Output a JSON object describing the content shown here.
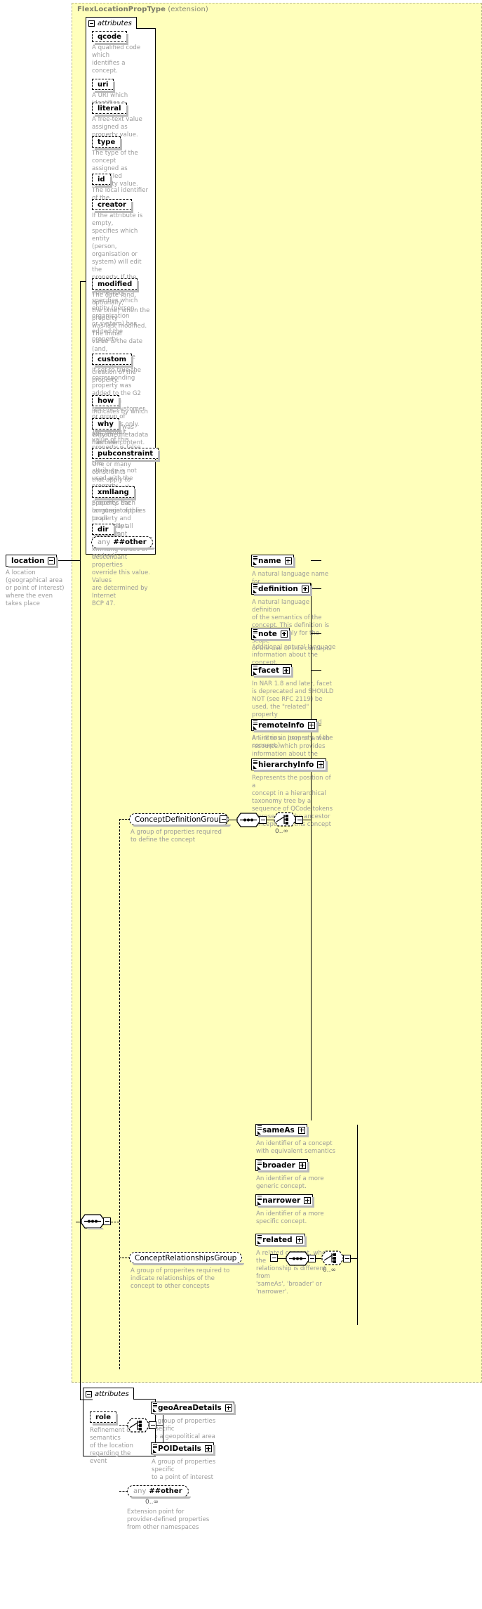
{
  "diagram": {
    "type_title_name": "FlexLocationPropType",
    "type_title_suffix": "(extension)",
    "attributes_label": "attributes",
    "attributes_label_bottom": "attributes"
  },
  "root": {
    "name": "location",
    "doc": "A location (geographical area\nor point of interest) where the even\ntakes place"
  },
  "type_attributes": [
    {
      "name": "qcode",
      "doc": "A qualified code which\nidentifies a concept."
    },
    {
      "name": "uri",
      "doc": "A URI which identifies a\nconcept."
    },
    {
      "name": "literal",
      "doc": "A free-text value assigned as\nproperty value."
    },
    {
      "name": "type",
      "doc": "The type of the concept\nassigned as controlled\nproperty value."
    },
    {
      "name": "id",
      "doc": "The local identifier of the\nproperty."
    },
    {
      "name": "creator",
      "doc": "If the attribute is empty,\nspecifies which entity\n(person, organisation or\nsystem) will edit the\nproperty. If the attribute is\nnon-empty, specifies which\nentity (person, organisation\nor system) has edited the\nproperty."
    },
    {
      "name": "modified",
      "doc": "The date (and, optionally,\nthe time) when the property\nwas last modified. The initial\nvalue is the date (and,\noptionally, the time) of\ncreation of the property."
    },
    {
      "name": "custom",
      "doc": "If set to true the\ncorresponding property was\nadded to the G2 Item for a\nspecific customer or group of\ncustomers only. The default\nvalue of this property is false\nwhich applies when this\nattribute is not used with the\nproperty."
    },
    {
      "name": "how",
      "doc": "Indicates by which means\nthe value was extracted\nfrom the content."
    },
    {
      "name": "why",
      "doc": "Why the metadata has been\nincluded."
    },
    {
      "name": "pubconstraint",
      "doc": "One or many constraints\nthat apply to publishing the\nvalue of the property. Each\nconstraint applies to all\ndescendant elements."
    },
    {
      "name": "xmllang",
      "doc": "Specifies the language of this\nproperty and potentially all\ndescendant properties.\nxml:lang values of\ndescendant properties\noverride this value. Values\nare determined by Internet\nBCP 47."
    },
    {
      "name": "dir",
      "doc": "The directionality of textual\ncontent."
    }
  ],
  "attr_any": {
    "any_word": "any",
    "namespace": "##other"
  },
  "groups": [
    {
      "name": "ConceptDefinitionGroup",
      "doc": "A group of properties required\nto define the concept",
      "occurs": "0..∞",
      "elements": [
        {
          "name": "name",
          "doc": "A natural language name for\nthe concept.",
          "expander": "plus"
        },
        {
          "name": "definition",
          "doc": "A natural language definition\nof the semantics of the\nconcept. This definition is\nnormative only for the scope\nof the use of this concept.",
          "expander": "plus"
        },
        {
          "name": "note",
          "doc": "Additional natural language\ninformation about the\nconcept.",
          "expander": "plus"
        },
        {
          "name": "facet",
          "doc": "In NAR 1.8 and later, facet\nis deprecated and SHOULD\nNOT (see RFC 2119) be\nused, the \"related\" property\nshould be used instead (was:\nAn intrinsic property of the\nconcept.)",
          "expander": "plus"
        },
        {
          "name": "remoteInfo",
          "doc": "A link to an item or a web\nresource which provides\ninformation about the\nconcept",
          "expander": "plus"
        },
        {
          "name": "hierarchyInfo",
          "doc": "Represents the position of a\nconcept in a hierarchical\ntaxonomy tree by a\nsequence of QCode tokens\nrepresenting the ancestor\nconcepts and this concept",
          "expander": "plus"
        }
      ]
    },
    {
      "name": "ConceptRelationshipsGroup",
      "doc": "A group of properites required to\nindicate relationships of the\nconcept to other concepts",
      "occurs": "0..∞",
      "elements": [
        {
          "name": "sameAs",
          "doc": "An identifier of a concept\nwith equivalent semantics",
          "expander": "plus"
        },
        {
          "name": "broader",
          "doc": "An identifier of a more\ngeneric concept.",
          "expander": "plus"
        },
        {
          "name": "narrower",
          "doc": "An identifier of a more\nspecific concept.",
          "expander": "plus"
        },
        {
          "name": "related",
          "doc": "A related concept, where the\nrelationship is different from\n'sameAs', 'broader' or\n'narrower'.",
          "expander": "plus"
        }
      ]
    }
  ],
  "details_choice": {
    "elements": [
      {
        "name": "geoAreaDetails",
        "doc": "A group of properties specific\nto a geopolitical area",
        "expander": "plus"
      },
      {
        "name": "POIDetails",
        "doc": "A group of properties specific\nto a point of interest",
        "expander": "plus"
      }
    ]
  },
  "content_any": {
    "any_word": "any",
    "namespace": "##other",
    "occurs": "0..∞",
    "doc": "Extension point for\nprovider-defined properties\nfrom other namespaces"
  },
  "bottom_attributes": [
    {
      "name": "role",
      "doc": "Refinement of the semantics\nof the location regarding the\nevent"
    }
  ],
  "colors": {
    "panel_bg": "#ffffbb",
    "panel_border": "#b9b98a",
    "doc_text": "#9a9a9a",
    "title_text": "#888878",
    "shadow": "#b8b8b8"
  }
}
